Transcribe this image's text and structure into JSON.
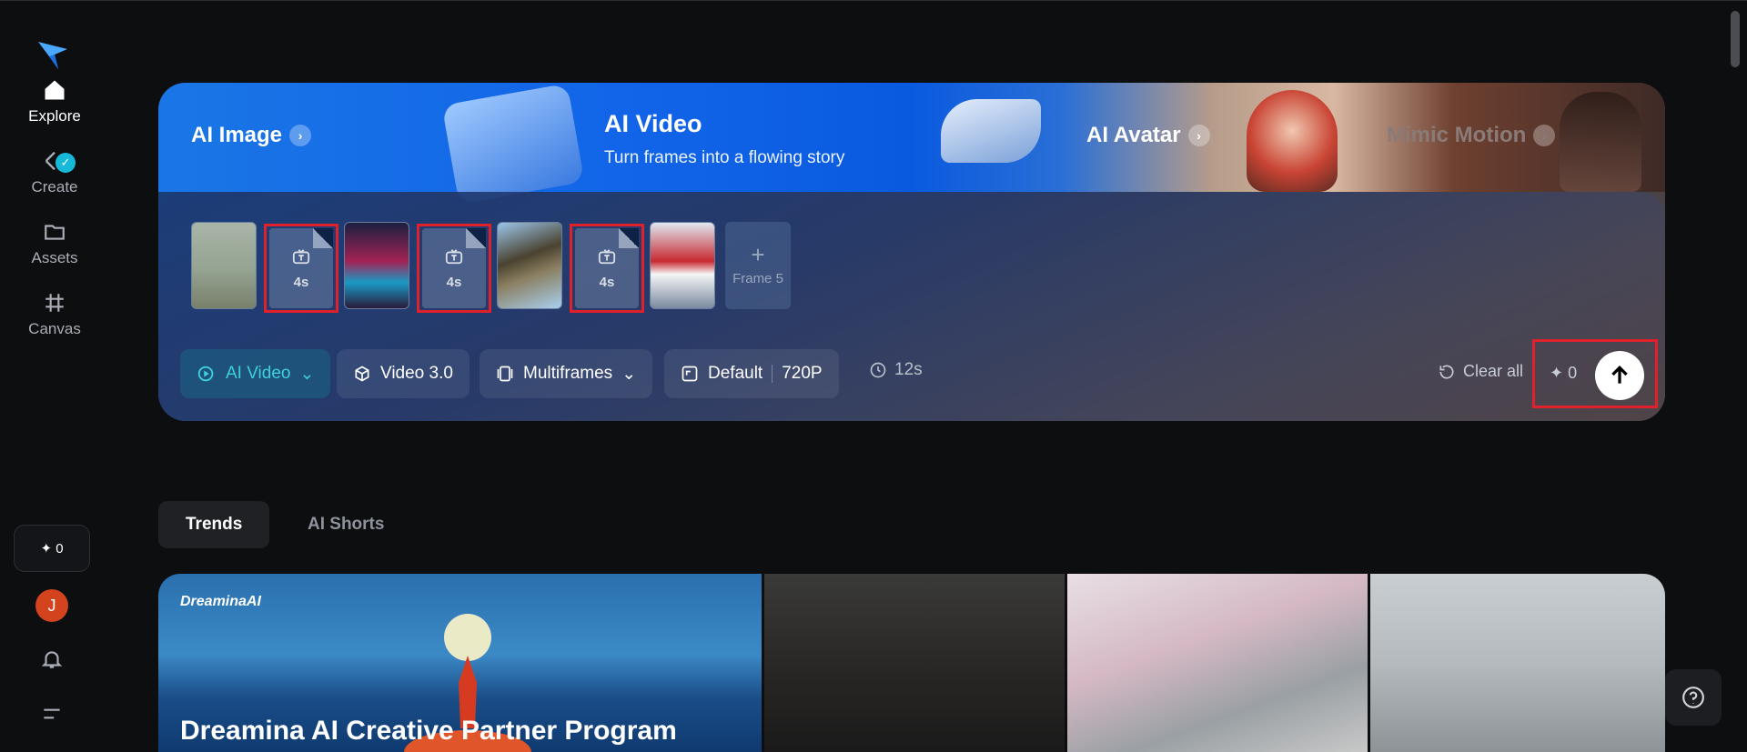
{
  "sidebar": {
    "items": [
      {
        "label": "Explore",
        "icon": "home-icon"
      },
      {
        "label": "Create",
        "icon": "create-icon"
      },
      {
        "label": "Assets",
        "icon": "folder-icon"
      },
      {
        "label": "Canvas",
        "icon": "canvas-icon"
      }
    ],
    "credits": "✦ 0",
    "avatar_initial": "J"
  },
  "banner": {
    "left_item": "AI Image",
    "title": "AI Video",
    "subtitle": "Turn frames into a flowing story",
    "right_item": "AI Avatar",
    "far_item": "Mimic Motion"
  },
  "frames": {
    "transition_label": "4s",
    "add_frame_label": "Frame 5"
  },
  "toolbar": {
    "mode": "AI Video",
    "model": "Video 3.0",
    "frames_mode": "Multiframes",
    "ratio": "Default",
    "resolution": "720P",
    "duration": "12s",
    "clear": "Clear all",
    "credits": "0"
  },
  "tabs": [
    "Trends",
    "AI Shorts"
  ],
  "gallery": {
    "brand": "DreaminaAI",
    "headline": "Dreamina AI Creative Partner Program"
  },
  "colors": {
    "accent": "#3ed0de",
    "highlight": "#e0202a",
    "background": "#0d0e10"
  }
}
